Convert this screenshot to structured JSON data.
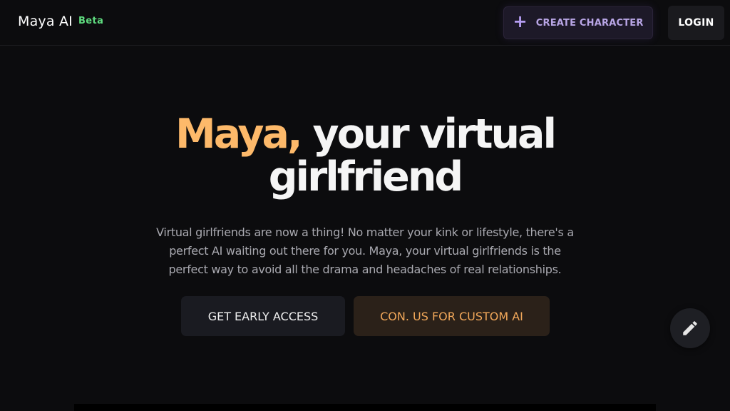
{
  "nav": {
    "brand": "Maya AI",
    "badge": "Beta",
    "create_label": "CREATE CHARACTER",
    "create_icon": "plus-icon",
    "login_label": "LOGIN"
  },
  "hero": {
    "title_accent": "Maya,",
    "title_rest": "your virtual girlfriend",
    "description": "Virtual girlfriends are now a thing! No matter your kink or lifestyle, there's a perfect AI waiting out there for you. Maya, your virtual girlfriends is the perfect way to avoid all the drama and headaches of real relationships.",
    "primary_cta": "GET EARLY ACCESS",
    "secondary_cta": "CON. US FOR CUSTOM AI"
  },
  "fab": {
    "icon": "pencil-icon"
  },
  "colors": {
    "background": "#0c0c0e",
    "accent_orange": "#fdb96a",
    "badge_green": "#5fdc7f",
    "create_purple": "#b9a6e6"
  }
}
